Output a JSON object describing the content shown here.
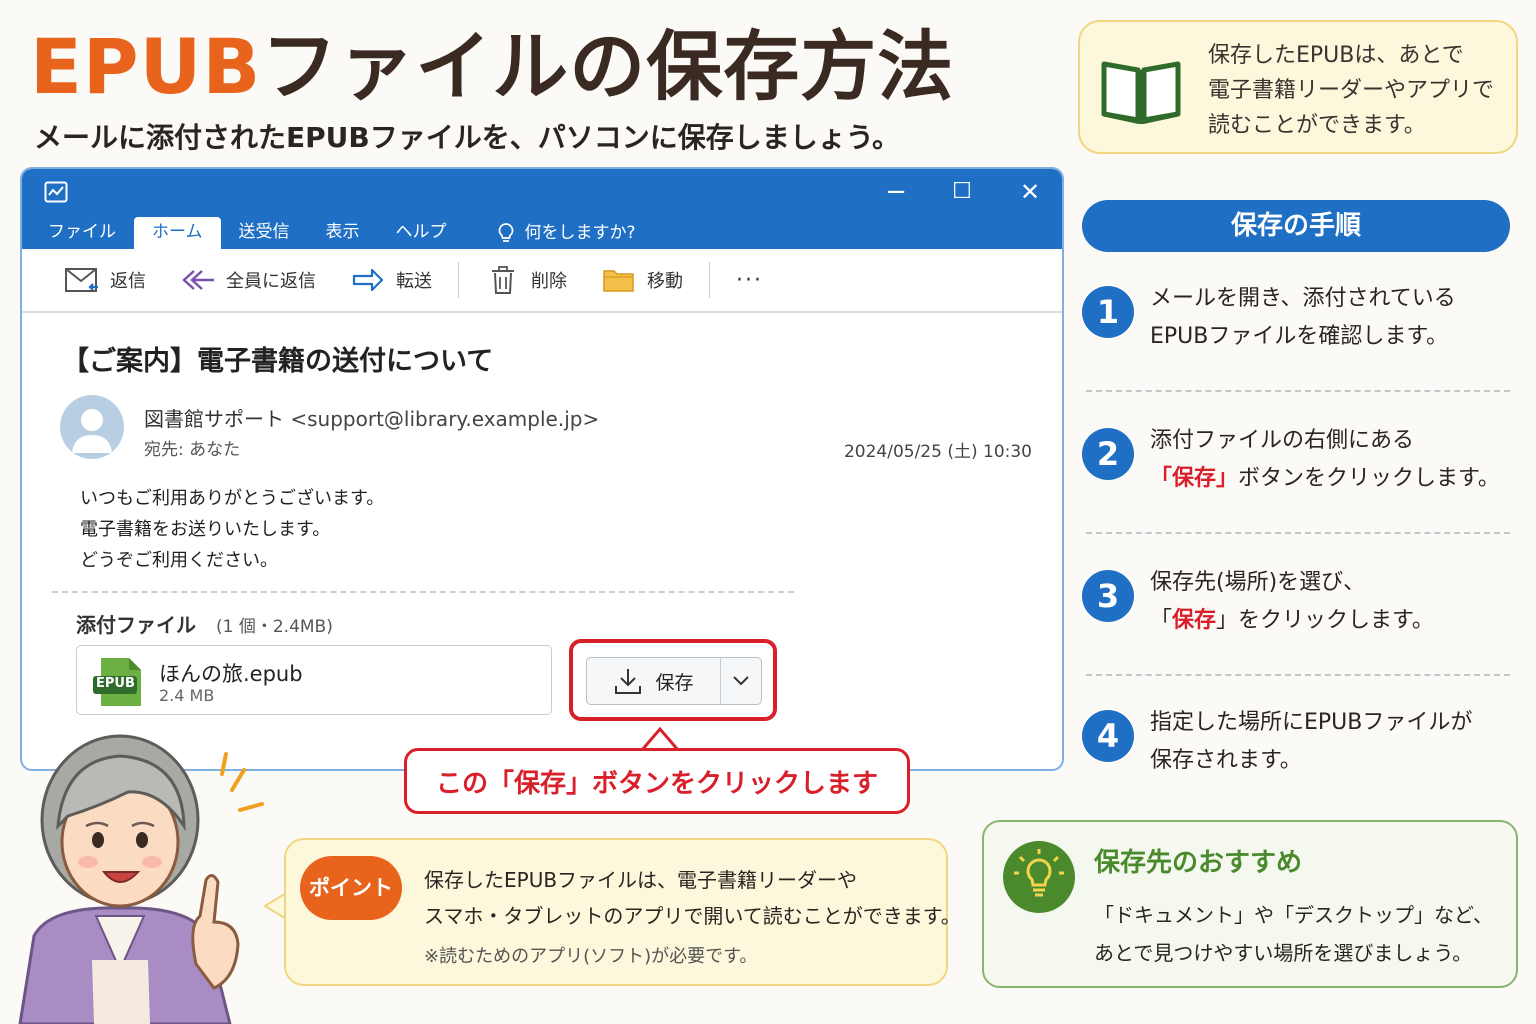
{
  "header": {
    "title_accent": "EPUB",
    "title_rest": "ファイルの保存方法",
    "subtitle": "メールに添付されたEPUBファイルを、パソコンに保存しましょう。"
  },
  "top_note": {
    "lines": [
      "保存したEPUBは、あとで",
      "電子書籍リーダーやアプリで",
      "読むことができます。"
    ],
    "icon": "book-icon"
  },
  "window": {
    "controls": {
      "minimize": "−",
      "maximize": "☐",
      "close": "✕"
    },
    "tabs": [
      "ファイル",
      "ホーム",
      "送受信",
      "表示",
      "ヘルプ"
    ],
    "active_tab": "ホーム",
    "search_label": "何をしますか?",
    "toolbar": {
      "reply": "返信",
      "reply_all": "全員に返信",
      "forward": "転送",
      "delete": "削除",
      "move": "移動",
      "more": "···"
    },
    "mail": {
      "subject": "【ご案内】電子書籍の送付について",
      "sender_name": "図書館サポート",
      "sender_addr": "<support@library.example.jp>",
      "to": "宛先: あなた",
      "date": "2024/05/25 (土) 10:30",
      "body": [
        "いつもご利用ありがとうございます。",
        "電子書籍をお送りいたします。",
        "どうぞご利用ください。"
      ],
      "attach_label": "添付ファイル",
      "attach_count": "(1 個・2.4MB)",
      "file_name": "ほんの旅.epub",
      "file_size": "2.4 MB",
      "file_badge": "EPUB",
      "save_label": "保存"
    }
  },
  "callout": "この「保存」ボタンをクリックします",
  "steps": {
    "header": "保存の手順",
    "items": [
      {
        "num": "1",
        "line1": "メールを開き、添付されている",
        "line2": "EPUBファイルを確認します。"
      },
      {
        "num": "2",
        "line1": "添付ファイルの右側にある",
        "line2_red": "「保存」",
        "line2_rest": "ボタンをクリックします。"
      },
      {
        "num": "3",
        "line1": "保存先(場所)を選び、",
        "line2_pre": "「",
        "line2_red": "保存",
        "line2_rest": "」をクリックします。"
      },
      {
        "num": "4",
        "line1": "指定した場所にEPUBファイルが",
        "line2": "保存されます。"
      }
    ]
  },
  "point": {
    "badge": "ポイント",
    "line1": "保存したEPUBファイルは、電子書籍リーダーや",
    "line2": "スマホ・タブレットのアプリで開いて読むことができます。",
    "note": "※読むためのアプリ(ソフト)が必要です。"
  },
  "recommend": {
    "title": "保存先のおすすめ",
    "line1": "「ドキュメント」や「デスクトップ」など、",
    "line2": "あとで見つけやすい場所を選びましょう。",
    "icon": "lightbulb-icon"
  },
  "colors": {
    "accent_orange": "#e8641c",
    "primary_blue": "#1f6fc5",
    "highlight_red": "#d9202a",
    "recommend_green": "#4a8a2c"
  }
}
